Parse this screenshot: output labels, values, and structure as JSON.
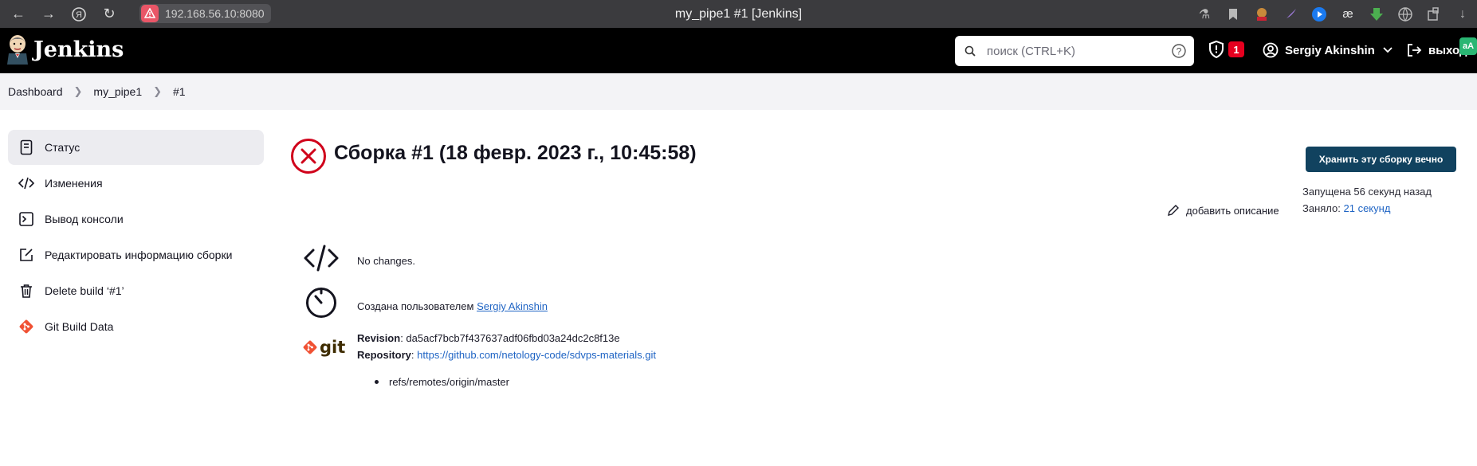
{
  "browser": {
    "url": "192.168.56.10:8080",
    "tab_title": "my_pipe1 #1 [Jenkins]"
  },
  "header": {
    "app_name": "Jenkins",
    "search_placeholder": "поиск (CTRL+K)",
    "security_count": "1",
    "user_name": "Sergiy Akinshin",
    "logout_label": "выход"
  },
  "breadcrumb": [
    "Dashboard",
    "my_pipe1",
    "#1"
  ],
  "sidebar": {
    "items": [
      {
        "label": "Статус",
        "icon": "document-icon",
        "active": true
      },
      {
        "label": "Изменения",
        "icon": "code-icon",
        "active": false
      },
      {
        "label": "Вывод консоли",
        "icon": "terminal-icon",
        "active": false
      },
      {
        "label": "Редактировать информацию сборки",
        "icon": "edit-icon",
        "active": false
      },
      {
        "label": "Delete build ‘#1’",
        "icon": "trash-icon",
        "active": false
      },
      {
        "label": "Git Build Data",
        "icon": "git-icon",
        "active": false
      }
    ]
  },
  "build": {
    "title": "Сборка #1 (18 февр. 2023 г., 10:45:58)",
    "status": "failed",
    "keep_button": "Хранить эту сборку вечно",
    "started": "Запущена 56 секунд назад",
    "took_label": "Заняло:",
    "took_value": "21 секунд",
    "add_description": "добавить описание",
    "changes_text": "No changes.",
    "started_by_text": "Создана пользователем",
    "started_by_user": "Sergiy Akinshin",
    "revision_label": "Revision",
    "revision_value": "da5acf7bcb7f437637adf06fbd03a24dc2c8f13e",
    "repository_label": "Repository",
    "repository_value": "https://github.com/netology-code/sdvps-materials.git",
    "branches": [
      "refs/remotes/origin/master"
    ],
    "git_logo_text": "git"
  },
  "colors": {
    "fail_red": "#d0021b",
    "header_bg": "#000000",
    "keep_button_bg": "#11425f",
    "link": "#1f64c4",
    "git_orange": "#f05133"
  }
}
